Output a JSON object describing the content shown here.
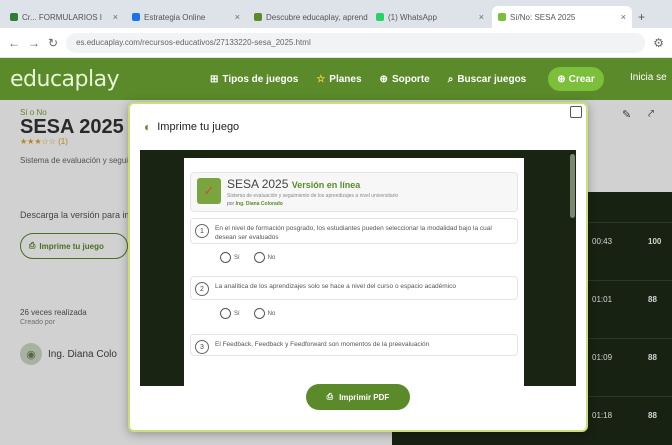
{
  "browser": {
    "tabs": [
      {
        "label": "Cr... FORMULARIOS I",
        "color": "#2e7d32"
      },
      {
        "label": "Estrategia Online",
        "color": "#1a73e8"
      },
      {
        "label": "Descubre educaplay, aprende",
        "color": "#5a8a2a"
      },
      {
        "label": "(1) WhatsApp",
        "color": "#25d366"
      },
      {
        "label": "Sí/No: SESA 2025",
        "color": "#7cbf3a"
      }
    ],
    "url": "es.educaplay.com/recursos-educativos/27133220-sesa_2025.html",
    "newtab": "+"
  },
  "site": {
    "logo": "educaplay",
    "menu": [
      {
        "icon": "grid-icon",
        "glyph": "⊞",
        "label": "Tipos de juegos"
      },
      {
        "icon": "star-icon",
        "glyph": "☆",
        "label": "Planes"
      },
      {
        "icon": "help-icon",
        "glyph": "⊕",
        "label": "Soporte"
      },
      {
        "icon": "search-icon",
        "glyph": "⌕",
        "label": "Buscar juegos"
      }
    ],
    "crear": "Crear",
    "login": "Inicia se"
  },
  "activity": {
    "type": "Sí o No",
    "title": "SESA 2025",
    "rating": "★★★☆☆ (1)",
    "desc": "Sistema de evaluación y seguimiento",
    "download": "Descarga la versión para imprimir",
    "print_label": "Imprime tu juego",
    "plays_label": "26 veces realizada",
    "author_label": "Creado por",
    "author": "Ing. Diana Colo"
  },
  "ranking": [
    {
      "time": "00:43",
      "score": "100"
    },
    {
      "time": "01:01",
      "score": "88"
    },
    {
      "time": "01:09",
      "score": "88"
    },
    {
      "time": "01:18",
      "score": "88"
    }
  ],
  "modal": {
    "title": "Imprime tu juego",
    "button": "Imprimir PDF",
    "sheet": {
      "title": "SESA 2025",
      "version": "Versión en línea",
      "subtitle": "Sistema de evaluación y seguimiento de los aprendizajes a nivel universitario",
      "author_prefix": "por",
      "author": "Ing. Diana Colorado",
      "options": [
        "Sí",
        "No"
      ],
      "questions": [
        {
          "num": "1",
          "text": "En el nivel de formación posgrado, los estudiantes pueden seleccionar la modalidad bajo la cual desean ser evaluados"
        },
        {
          "num": "2",
          "text": "La analítica de los aprendizajes solo se hace a nivel del curso o espacio académico"
        },
        {
          "num": "3",
          "text": "El Feedback, Feedback y Feedforward son momentos de la preevaluación"
        }
      ]
    }
  }
}
